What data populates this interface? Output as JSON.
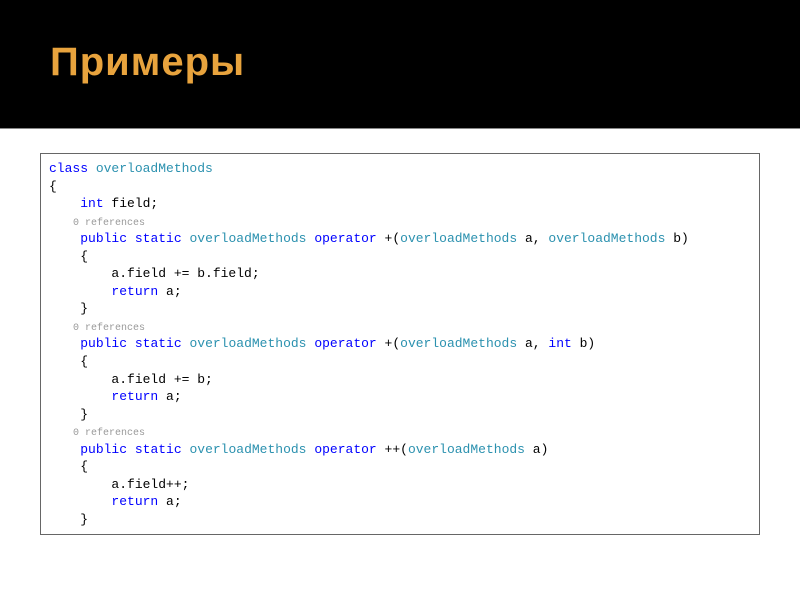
{
  "slide": {
    "title": "Примеры"
  },
  "code": {
    "l1_kw": "class",
    "l1_cls": " overloadMethods",
    "l2": "{",
    "l3_ind": "    ",
    "l3_kw": "int",
    "l3_rest": " field;",
    "ref": "    0 references",
    "l4_ind": "    ",
    "l4_kw1": "public",
    "l4_sp1": " ",
    "l4_kw2": "static",
    "l4_sp2": " ",
    "l4_cls1": "overloadMethods",
    "l4_sp3": " ",
    "l4_kw3": "operator",
    "l4_op": " +(",
    "l4_cls2": "overloadMethods",
    "l4_a": " a, ",
    "l4_cls3": "overloadMethods",
    "l4_end": " b)",
    "l5": "    {",
    "l6": "        a.field += b.field;",
    "l7_ind": "        ",
    "l7_kw": "return",
    "l7_rest": " a;",
    "l8": "    }",
    "l9_ind": "    ",
    "l9_kw1": "public",
    "l9_sp1": " ",
    "l9_kw2": "static",
    "l9_sp2": " ",
    "l9_cls1": "overloadMethods",
    "l9_sp3": " ",
    "l9_kw3": "operator",
    "l9_op": " +(",
    "l9_cls2": "overloadMethods",
    "l9_a": " a, ",
    "l9_kw4": "int",
    "l9_end": " b)",
    "l10": "    {",
    "l11": "        a.field += b;",
    "l12_ind": "        ",
    "l12_kw": "return",
    "l12_rest": " a;",
    "l13": "    }",
    "l14_ind": "    ",
    "l14_kw1": "public",
    "l14_sp1": " ",
    "l14_kw2": "static",
    "l14_sp2": " ",
    "l14_cls1": "overloadMethods",
    "l14_sp3": " ",
    "l14_kw3": "operator",
    "l14_op": " ++(",
    "l14_cls2": "overloadMethods",
    "l14_end": " a)",
    "l15": "    {",
    "l16": "        a.field++;",
    "l17_ind": "        ",
    "l17_kw": "return",
    "l17_rest": " a;",
    "l18": "    }"
  }
}
